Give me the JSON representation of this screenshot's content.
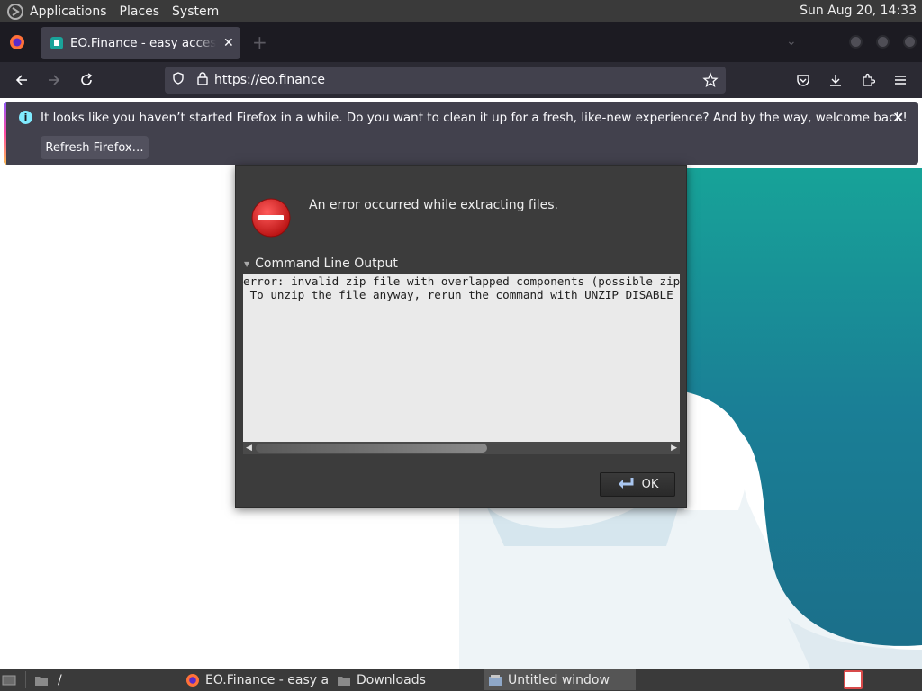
{
  "top_panel": {
    "menus": [
      "Applications",
      "Places",
      "System"
    ],
    "clock": "Sun Aug 20, 14:33"
  },
  "browser": {
    "tab_title": "EO.Finance - easy access to",
    "url": "https://eo.finance",
    "notification": {
      "message": "It looks like you haven’t started Firefox in a while. Do you want to clean it up for a fresh, like-new experience? And by the way, welcome back!",
      "button": "Refresh Firefox…"
    }
  },
  "dialog": {
    "message": "An error occurred while extracting files.",
    "expander_label": "Command Line Output",
    "output_lines": [
      "error: invalid zip file with overlapped components (possible zip bomb)",
      " To unzip the file anyway, rerun the command with UNZIP_DISABLE_ZIPBOMB_DETECTION=TRUE environmnent variable"
    ],
    "ok_label": "OK"
  },
  "taskbar": {
    "path_label": "/",
    "tasks": [
      "EO.Finance - easy a…",
      "Downloads",
      "Untitled window"
    ]
  },
  "colors": {
    "panel": "#3a3a3a",
    "browser_bg": "#2b2a33",
    "dialog_bg": "#3c3c3c",
    "teal": "#138a8a"
  }
}
